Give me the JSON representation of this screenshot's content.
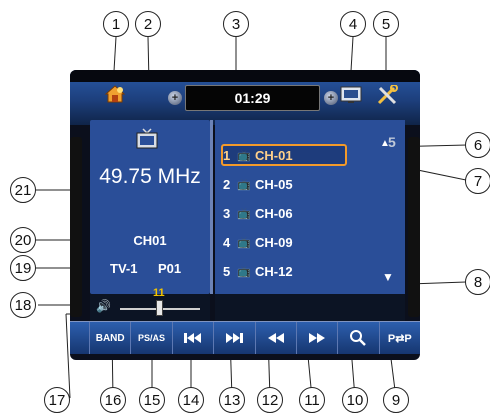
{
  "callouts": [
    "1",
    "2",
    "3",
    "4",
    "5",
    "6",
    "7",
    "8",
    "9",
    "10",
    "11",
    "12",
    "13",
    "14",
    "15",
    "16",
    "17",
    "18",
    "19",
    "20",
    "21"
  ],
  "topbar": {
    "clock": "01:29",
    "icons": [
      "home-icon",
      "tv-icon",
      "screen-icon",
      "settings-icon"
    ]
  },
  "tuner": {
    "frequency": "49.75 MHz",
    "channel_name": "CH01",
    "source": "TV-1",
    "preset": "P01"
  },
  "channel_list": {
    "page": "5",
    "items": [
      {
        "num": "1",
        "label": "CH-01",
        "selected": true
      },
      {
        "num": "2",
        "label": "CH-05",
        "selected": false
      },
      {
        "num": "3",
        "label": "CH-06",
        "selected": false
      },
      {
        "num": "4",
        "label": "CH-09",
        "selected": false
      },
      {
        "num": "5",
        "label": "CH-12",
        "selected": false
      }
    ]
  },
  "volume": {
    "value": "11",
    "level": 0.5
  },
  "buttons": {
    "band": "BAND",
    "ps_as": "PS/AS",
    "p_swap": "P⇄P"
  },
  "colors": {
    "panel": "#2a4e98",
    "highlight": "#f39a2a",
    "volume_text": "#f3c400"
  }
}
